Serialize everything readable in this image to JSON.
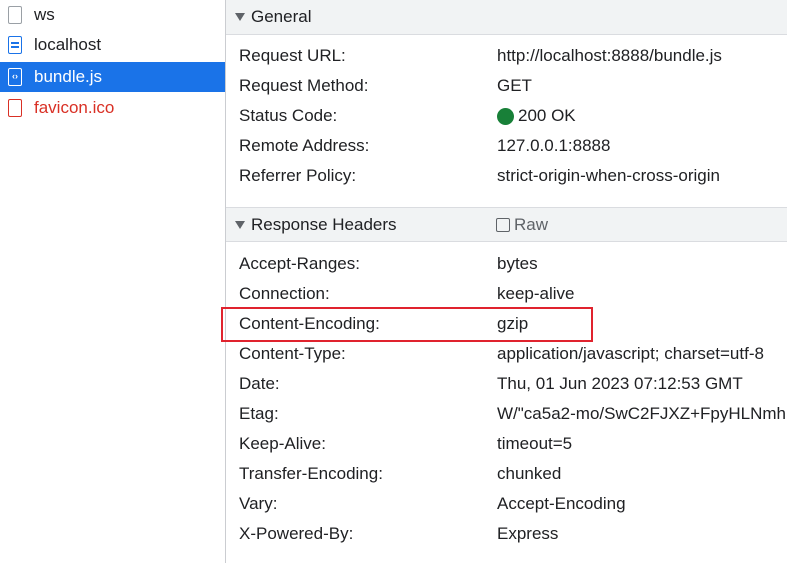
{
  "requests": [
    {
      "name": "ws",
      "icon": "blank-doc-icon"
    },
    {
      "name": "localhost",
      "icon": "document-icon"
    },
    {
      "name": "bundle.js",
      "icon": "script-icon",
      "selected": true
    },
    {
      "name": "favicon.ico",
      "icon": "error-doc-icon",
      "status": "error"
    }
  ],
  "script_icon_glyph": "‹›",
  "general": {
    "title": "General",
    "rows": [
      {
        "key": "Request URL:",
        "value": "http://localhost:8888/bundle.js"
      },
      {
        "key": "Request Method:",
        "value": "GET"
      },
      {
        "key": "Status Code:",
        "value": "200 OK"
      },
      {
        "key": "Remote Address:",
        "value": "127.0.0.1:8888"
      },
      {
        "key": "Referrer Policy:",
        "value": "strict-origin-when-cross-origin"
      }
    ]
  },
  "response_headers": {
    "title": "Response Headers",
    "raw_label": "Raw",
    "raw_checked": false,
    "rows": [
      {
        "key": "Accept-Ranges:",
        "value": "bytes"
      },
      {
        "key": "Connection:",
        "value": "keep-alive"
      },
      {
        "key": "Content-Encoding:",
        "value": "gzip"
      },
      {
        "key": "Content-Type:",
        "value": "application/javascript; charset=utf-8"
      },
      {
        "key": "Date:",
        "value": "Thu, 01 Jun 2023 07:12:53 GMT"
      },
      {
        "key": "Etag:",
        "value": "W/\"ca5a2-mo/SwC2FJXZ+FpyHLNmh"
      },
      {
        "key": "Keep-Alive:",
        "value": "timeout=5"
      },
      {
        "key": "Transfer-Encoding:",
        "value": "chunked"
      },
      {
        "key": "Vary:",
        "value": "Accept-Encoding"
      },
      {
        "key": "X-Powered-By:",
        "value": "Express"
      }
    ]
  },
  "colors": {
    "selected": "#1a73e8",
    "error": "#d93025",
    "status_ok": "#188038",
    "highlight": "#e0232e"
  }
}
